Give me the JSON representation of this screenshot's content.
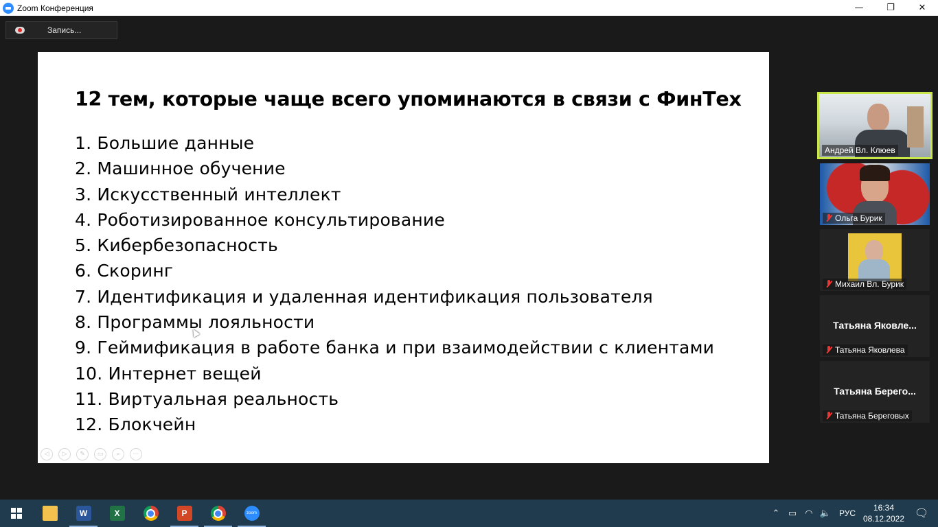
{
  "window": {
    "title": "Zoom Конференция",
    "controls": {
      "minimize": "—",
      "restore": "❐",
      "close": "✕"
    }
  },
  "recording": {
    "label": "Запись..."
  },
  "slide": {
    "title": "12 тем, которые чаще всего упоминаются в связи с ФинТех",
    "items": [
      "1. Большие данные",
      "2. Машинное обучение",
      "3. Искусственный интеллект",
      "4. Роботизированное консультирование",
      "5. Кибербезопасность",
      "6. Скоринг",
      "7. Идентификация и удаленная идентификация пользователя",
      "8. Программы лояльности",
      "9. Геймификация в работе банка и при взаимодействии с клиентами",
      "10. Интернет вещей",
      "11. Виртуальная реальность",
      "12. Блокчейн"
    ],
    "tools": [
      "◁",
      "▷",
      "✎",
      "▭",
      "⌕",
      "⋯"
    ]
  },
  "participants": [
    {
      "name": "Андрей Вл. Клюев",
      "muted": false,
      "active": true
    },
    {
      "name": "Ольга Бурик",
      "muted": true,
      "active": false
    },
    {
      "name": "Михаил Вл. Бурик",
      "muted": true,
      "active": false
    },
    {
      "name": "Татьяна Яковлева",
      "display_name": "Татьяна  Яковле...",
      "muted": true,
      "active": false
    },
    {
      "name": "Татьяна Береговых",
      "display_name": "Татьяна  Берего...",
      "muted": true,
      "active": false
    }
  ],
  "taskbar": {
    "apps": [
      {
        "name": "file-explorer",
        "glyph": ""
      },
      {
        "name": "word",
        "glyph": "W"
      },
      {
        "name": "excel",
        "glyph": "X"
      },
      {
        "name": "chrome",
        "glyph": ""
      },
      {
        "name": "powerpoint",
        "glyph": "P"
      },
      {
        "name": "chrome",
        "glyph": ""
      },
      {
        "name": "zoom",
        "glyph": "zoom"
      }
    ],
    "tray": {
      "chevron": "⌃",
      "battery": "▭",
      "network": "◠",
      "volume": "🔈",
      "language": "РУС",
      "time": "16:34",
      "date": "08.12.2022",
      "notifications": "🗨"
    }
  }
}
